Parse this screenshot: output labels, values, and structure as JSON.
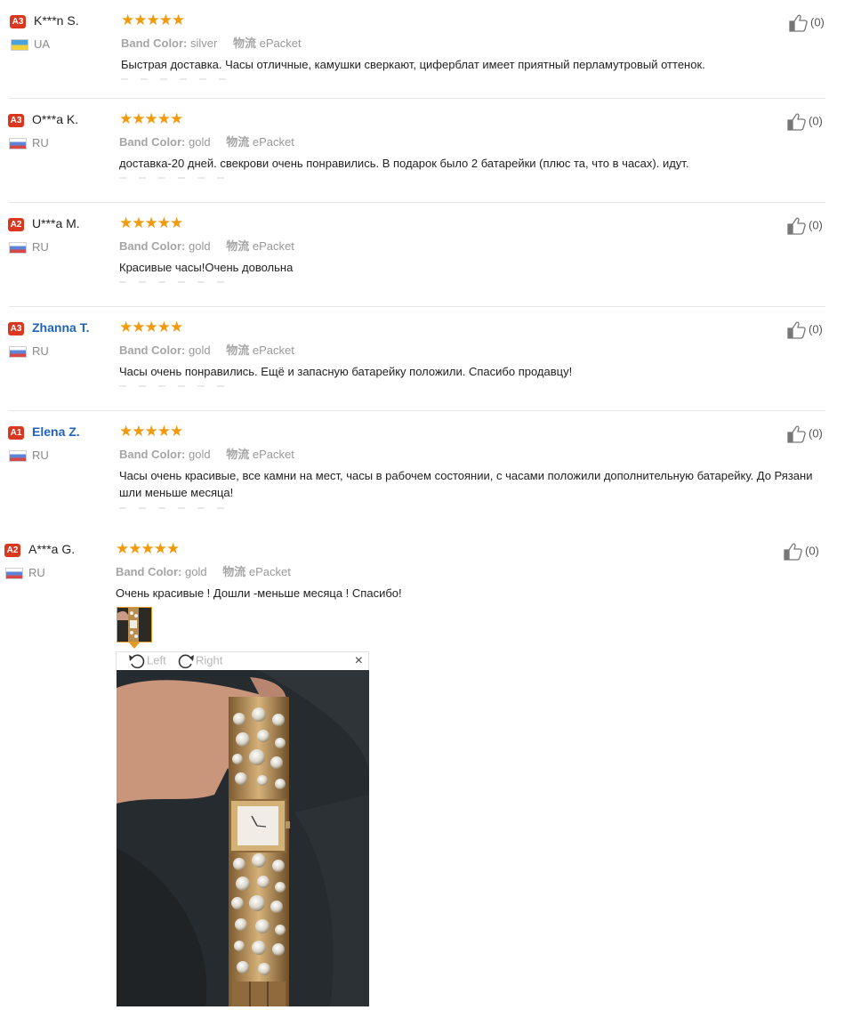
{
  "labels": {
    "band_color": "Band Color:",
    "shipping": "物流"
  },
  "reviews": [
    {
      "level": "A3",
      "name": "K***n S.",
      "country": "UA",
      "stars": "★★★★★",
      "band_color": "silver",
      "shipping": "ePacket",
      "text": "Быстрая доставка. Часы отличные, камушки сверкают, циферблат имеет приятный перламутровый оттенок.",
      "likes": "(0)"
    },
    {
      "level": "A3",
      "name": "O***a K.",
      "country": "RU",
      "stars": "★★★★★",
      "band_color": "gold",
      "shipping": "ePacket",
      "text": "доставка-20 дней. свекрови очень понравились. В подарок было 2 батарейки (плюс та, что в часах). идут.",
      "likes": "(0)"
    },
    {
      "level": "A2",
      "name": "U***a M.",
      "country": "RU",
      "stars": "★★★★★",
      "band_color": "gold",
      "shipping": "ePacket",
      "text": "Красивые часы!Очень довольна",
      "likes": "(0)"
    },
    {
      "level": "A3",
      "name": "Zhanna T.",
      "country": "RU",
      "stars": "★★★★★",
      "band_color": "gold",
      "shipping": "ePacket",
      "text": "Часы очень понравились. Ещё и запасную батарейку положили. Спасибо продавцу!",
      "likes": "(0)"
    },
    {
      "level": "A1",
      "name": "Elena Z.",
      "country": "RU",
      "stars": "★★★★★",
      "band_color": "gold",
      "shipping": "ePacket",
      "text": "Часы очень красивые, все камни на мест, часы в рабочем состоянии, с часами положили дополнительную батарейку. До Рязани шли меньше месяца!",
      "likes": "(0)"
    },
    {
      "level": "A2",
      "name": "A***a G.",
      "country": "RU",
      "stars": "★★★★★",
      "band_color": "gold",
      "shipping": "ePacket",
      "text": "Очень красивые ! Дошли -меньше месяца ! Спасибо!",
      "likes": "(0)"
    }
  ],
  "viewer": {
    "rotate_left": "Left",
    "rotate_right": "Right",
    "close": "×"
  },
  "colors": {
    "level_badge": "#d9371f",
    "stars": "#f19a0e",
    "username_link": "#2163b8"
  },
  "icons": {
    "like": "thumbs-up-icon",
    "rotate_left": "rotate-left-icon",
    "rotate_right": "rotate-right-icon",
    "close": "close-icon"
  }
}
